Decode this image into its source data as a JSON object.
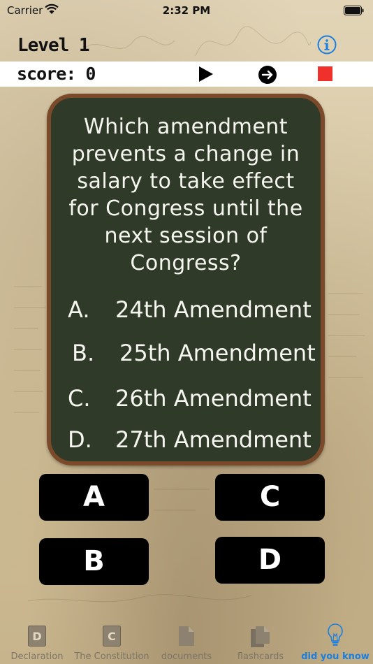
{
  "status_bar": {
    "carrier": "Carrier",
    "time": "2:32 PM"
  },
  "header": {
    "level": "Level 1",
    "score_label": "score:",
    "score": "0",
    "icons": [
      "info-icon",
      "play-icon",
      "next-arrow-icon",
      "stop-icon"
    ]
  },
  "question": {
    "text": "Which amendment prevents a change in salary to take effect for Congress until the next session of Congress?",
    "answers": [
      {
        "letter": "A.",
        "text": "24th Amendment"
      },
      {
        "letter": "B.",
        "text": "25th Amendment"
      },
      {
        "letter": "C.",
        "text": "26th Amendment"
      },
      {
        "letter": "D.",
        "text": "27th Amendment"
      }
    ]
  },
  "buttons": {
    "a": "A",
    "b": "B",
    "c": "C",
    "d": "D"
  },
  "tabs": [
    {
      "label": "Declaration",
      "icon": "letter-d-icon",
      "glyph": "D"
    },
    {
      "label": "The Constitution",
      "icon": "letter-c-icon",
      "glyph": "C"
    },
    {
      "label": "documents",
      "icon": "document-icon"
    },
    {
      "label": "flashcards",
      "icon": "flashcards-icon"
    },
    {
      "label": "did you know",
      "icon": "lightbulb-icon",
      "active": true
    }
  ],
  "colors": {
    "accent": "#1a7fe0",
    "chalkboard": "#2f3a28",
    "frame": "#7a4a2a",
    "stop": "#f0302a"
  }
}
